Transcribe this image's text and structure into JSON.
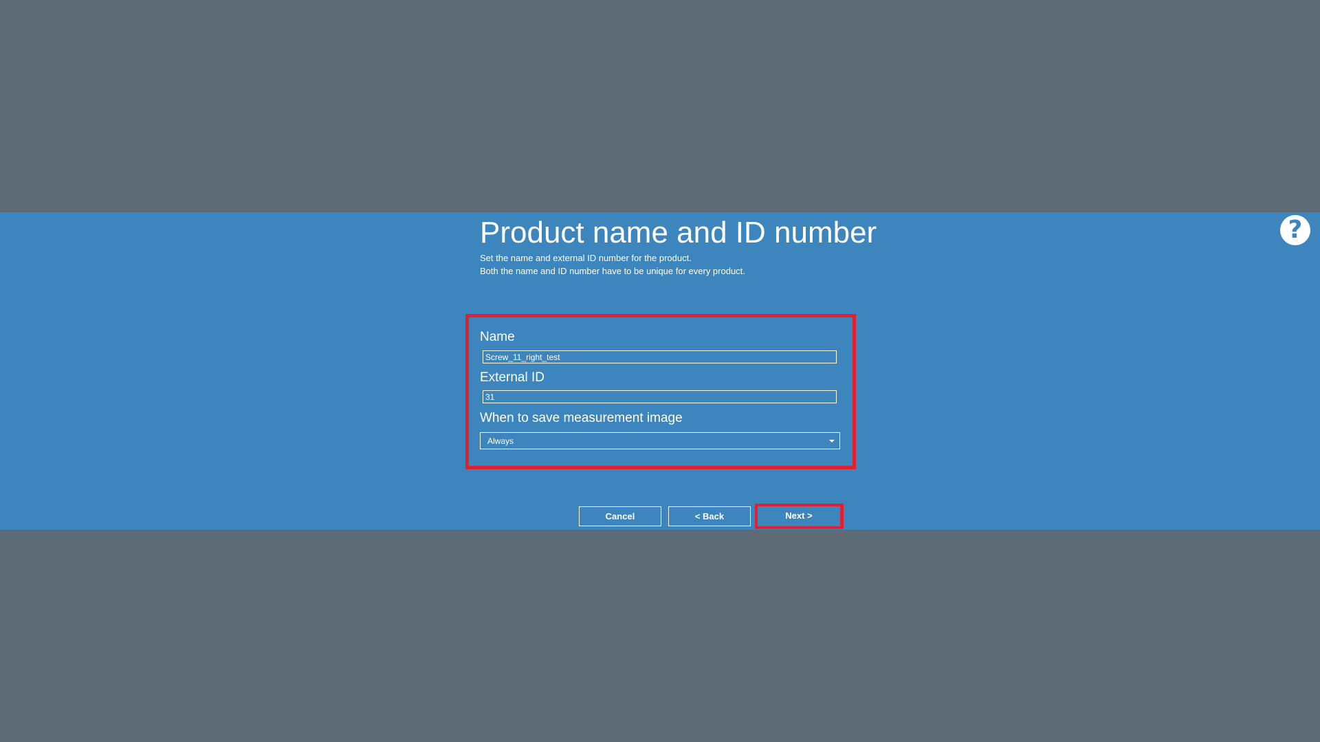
{
  "dialog": {
    "title": "Product name and ID number",
    "subtitle_line1": "Set the name and external ID number for the product.",
    "subtitle_line2": "Both the name and ID number have to be unique for every product.",
    "help_icon": "?"
  },
  "form": {
    "name_label": "Name",
    "name_value": "Screw_11_right_test",
    "external_id_label": "External ID",
    "external_id_value": "31",
    "save_image_label": "When to save measurement image",
    "save_image_selected": "Always"
  },
  "buttons": {
    "cancel": "Cancel",
    "back": "< Back",
    "next": "Next >"
  },
  "colors": {
    "backdrop": "#5e6a74",
    "dialog_background": "#3d85bd",
    "highlight": "#e3202e",
    "text": "#ffffff"
  },
  "icons": {
    "help": "question-circle-icon",
    "dropdown": "chevron-down-icon"
  }
}
